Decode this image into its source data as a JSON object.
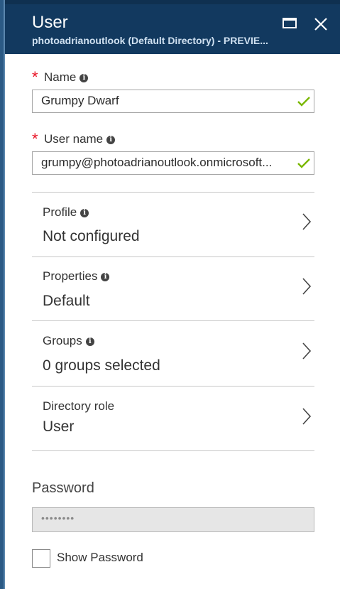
{
  "header": {
    "title": "User",
    "subtitle": "photoadrianoutlook (Default Directory) - PREVIE..."
  },
  "fields": {
    "name": {
      "label": "Name",
      "value": "Grumpy Dwarf",
      "required": true
    },
    "username": {
      "label": "User name",
      "value": "grumpy@photoadrianoutlook.onmicrosoft...",
      "required": true
    }
  },
  "rows": [
    {
      "label": "Profile",
      "value": "Not configured",
      "info": true
    },
    {
      "label": "Properties",
      "value": "Default",
      "info": true
    },
    {
      "label": "Groups",
      "value": "0 groups selected",
      "info": true
    },
    {
      "label": "Directory role",
      "value": "User",
      "info": false
    }
  ],
  "password": {
    "label": "Password",
    "masked_value": "••••••••",
    "show_label": "Show Password",
    "show_checked": false
  },
  "colors": {
    "header_bg": "#12395f",
    "required": "#e81123",
    "valid_check": "#7ab800"
  },
  "icons": [
    "maximize-icon",
    "close-icon",
    "info-icon",
    "check-icon",
    "chevron-right-icon"
  ]
}
